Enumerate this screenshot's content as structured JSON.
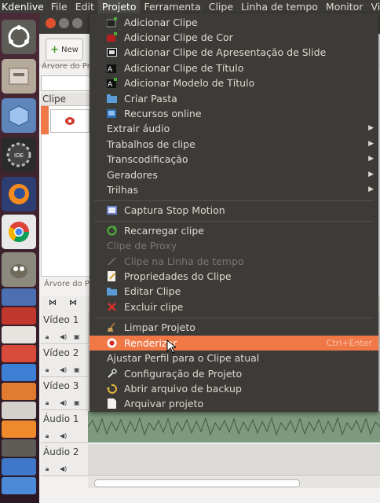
{
  "menubar": {
    "app": "Kdenlive",
    "items": [
      "File",
      "Edit",
      "Projeto",
      "Ferramenta",
      "Clipe",
      "Linha de tempo",
      "Monitor",
      "Visualiz"
    ]
  },
  "window": {
    "new_button": "New",
    "project_tree_label": "Árvore do Proje",
    "clip_header": "Clipe",
    "project_tree_label2": "Árvore do Pro",
    "tracks": [
      "Vídeo 1",
      "Vídeo 2",
      "Vídeo 3",
      "Áudio 1",
      "Áudio 2"
    ]
  },
  "menu": {
    "items": [
      {
        "label": "Adicionar Clipe"
      },
      {
        "label": "Adicionar Clipe de Cor"
      },
      {
        "label": "Adicionar Clipe de Apresentação de Slide"
      },
      {
        "label": "Adicionar Clipe de Título"
      },
      {
        "label": "Adicionar Modelo de Título"
      },
      {
        "label": "Criar Pasta"
      },
      {
        "label": "Recursos online"
      },
      {
        "label": "Extrair áudio"
      },
      {
        "label": "Trabalhos de clipe"
      },
      {
        "label": "Transcodificação"
      },
      {
        "label": "Geradores"
      },
      {
        "label": "Trilhas"
      },
      {
        "label": "Captura Stop Motion"
      },
      {
        "label": "Recarregar clipe"
      },
      {
        "label": "Clipe de Proxy"
      },
      {
        "label": "Clipe na Linha de tempo"
      },
      {
        "label": "Propriedades do Clipe"
      },
      {
        "label": "Editar Clipe"
      },
      {
        "label": "Excluir clipe"
      },
      {
        "label": "Limpar Projeto"
      },
      {
        "label": "Renderizar",
        "shortcut": "Ctrl+Enter"
      },
      {
        "label": "Ajustar Perfil para o Clipe atual"
      },
      {
        "label": "Configuração de Projeto"
      },
      {
        "label": "Abrir arquivo de backup"
      },
      {
        "label": "Arquivar projeto"
      }
    ]
  },
  "colors": {
    "highlight": "#f07746",
    "menu_bg": "#3c3b37",
    "menubar_bg": "#3c3b37"
  }
}
